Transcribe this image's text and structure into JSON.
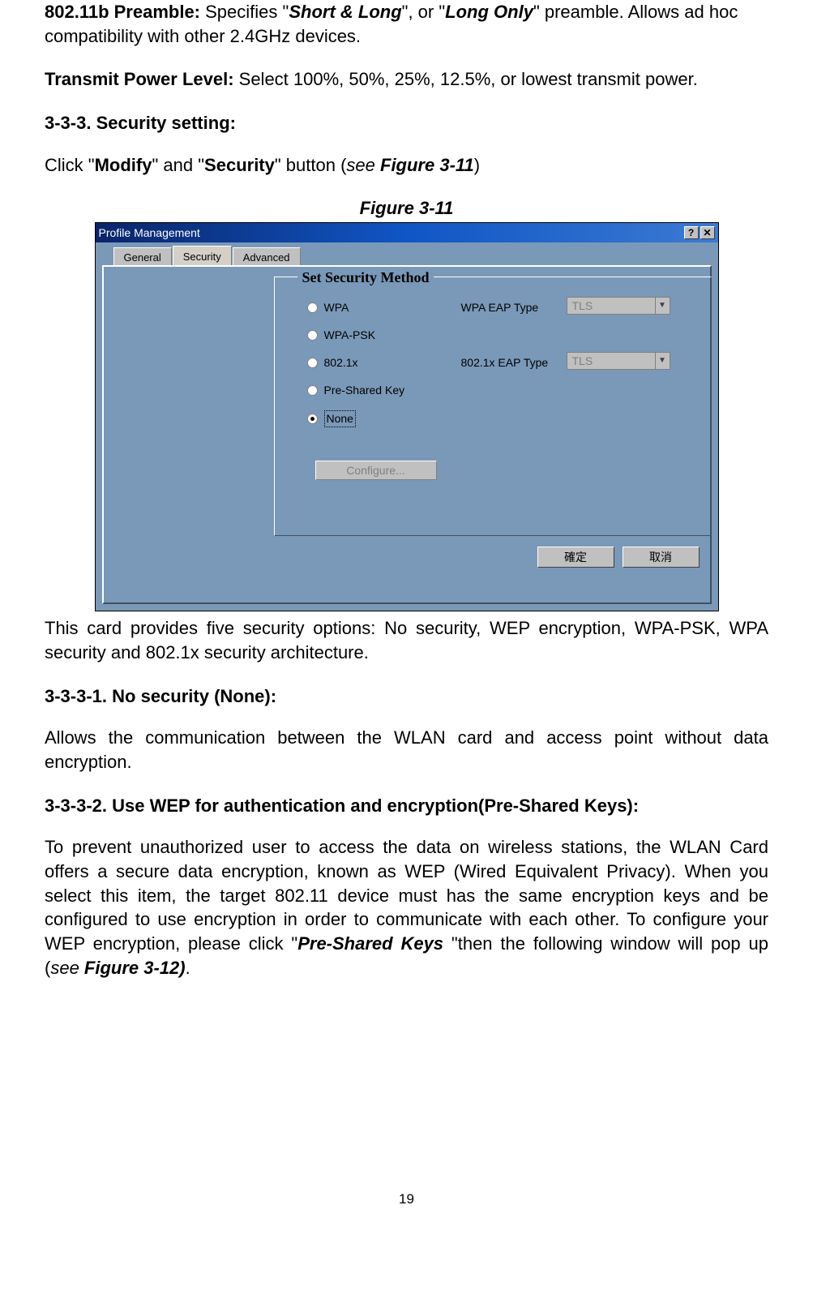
{
  "page_number": "19",
  "p_preamble": {
    "label": "802.11b Preamble: ",
    "t1": "Specifies \"",
    "opt1": "Short & Long",
    "t2": "\", or \"",
    "opt2": "Long Only",
    "t3": "\" preamble. Allows ad hoc compatibility with other 2.4GHz devices."
  },
  "p_power": {
    "label": "Transmit Power Level: ",
    "text": "Select 100%, 50%, 25%, 12.5%, or lowest transmit power."
  },
  "h_sec": "3-3-3. Security setting:",
  "p_click": {
    "t1": "Click \"",
    "b1": "Modify",
    "t2": "\" and \"",
    "b2": "Security",
    "t3": "\" button (",
    "see": "see ",
    "fig": "Figure 3-11",
    "t4": ")"
  },
  "fig_caption": "Figure 3-11",
  "dialog": {
    "title": "Profile Management",
    "tabs": {
      "general": "General",
      "security": "Security",
      "advanced": "Advanced"
    },
    "group_title": "Set Security Method",
    "radios": {
      "wpa": "WPA",
      "wpapsk": "WPA-PSK",
      "dot1x": "802.1x",
      "psk": "Pre-Shared Key",
      "none": "None"
    },
    "eap1_label": "WPA EAP Type",
    "eap2_label": "802.1x EAP Type",
    "combo_text": "TLS",
    "configure": "Configure...",
    "ok": "確定",
    "cancel": "取消"
  },
  "p_options": "This card provides five security options: No security, WEP encryption, WPA-PSK, WPA security and 802.1x security architecture.",
  "h_none": "3-3-3-1. No security (None):",
  "p_none": "Allows the communication between the WLAN card and access point without data encryption.",
  "h_wep": "3-3-3-2. Use WEP for authentication and encryption(Pre-Shared Keys):",
  "p_wep": {
    "t1": "To prevent unauthorized user to access the data on wireless stations, the WLAN Card offers a secure data encryption, known as WEP (Wired Equivalent Privacy). When you select this item, the target 802.11 device must has the same encryption keys and be configured to use encryption in order to communicate with each other. To configure your WEP encryption, please click \"",
    "b1": "Pre-Shared Keys ",
    "t2": "\"then the following window will pop up (",
    "see": "see ",
    "fig": "Figure 3-12)",
    "t3": "."
  }
}
